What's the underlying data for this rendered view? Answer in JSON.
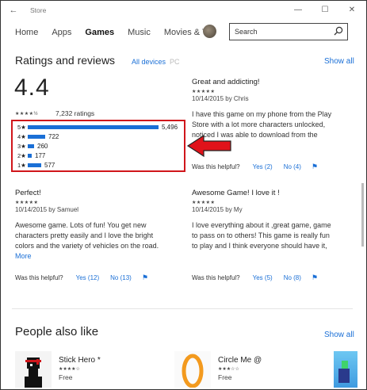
{
  "window": {
    "title": "Store",
    "back_glyph": "←",
    "min_glyph": "—",
    "max_glyph": "☐",
    "close_glyph": "✕"
  },
  "nav": {
    "tabs": [
      "Home",
      "Apps",
      "Games",
      "Music",
      "Movies & TV"
    ],
    "active": "Games",
    "search_placeholder": "Search"
  },
  "ratings": {
    "title": "Ratings and reviews",
    "filter_all": "All devices",
    "filter_pc": "PC",
    "show_all": "Show all",
    "average": "4.4",
    "average_stars": "★★★★½",
    "total": "7,232 ratings",
    "histogram": [
      {
        "label": "5★",
        "count": "5,496",
        "value": 5496
      },
      {
        "label": "4★",
        "count": "722",
        "value": 722
      },
      {
        "label": "3★",
        "count": "260",
        "value": 260
      },
      {
        "label": "2★",
        "count": "177",
        "value": 177
      },
      {
        "label": "1★",
        "count": "577",
        "value": 577
      }
    ]
  },
  "reviews": [
    {
      "title": "Great and addicting!",
      "stars": "★★★★★",
      "meta": "10/14/2015 by Chris",
      "body_lines": [
        "I have this game on my phone from the Play",
        "Store with a lot more characters unlocked,",
        "noticed I was able to download from the"
      ],
      "helpful": "Was this helpful?",
      "yes": "Yes (2)",
      "no": "No (4)"
    },
    {
      "title": "Perfect!",
      "stars": "★★★★★",
      "meta": "10/14/2015 by Samuel",
      "body_lines": [
        "Awesome game. Lots of fun! You get new",
        "characters pretty easily and I love the bright",
        "colors and the variety of vehicles on the road."
      ],
      "more": "More",
      "helpful": "Was this helpful?",
      "yes": "Yes (12)",
      "no": "No (13)"
    },
    {
      "title": "Awesome Game! I love it !",
      "stars": "★★★★★",
      "meta": "10/14/2015 by My",
      "body_lines": [
        "I love everything about it ,great game, game",
        "to pass on to others! This game is really fun",
        "to play and I think everyone should have it,"
      ],
      "helpful": "Was this helpful?",
      "yes": "Yes (5)",
      "no": "No (8)"
    }
  ],
  "people": {
    "title": "People also like",
    "show_all": "Show all",
    "apps": [
      {
        "name": "Stick Hero *",
        "stars": "★★★★☆",
        "price": "Free"
      },
      {
        "name": "Circle Me @",
        "stars": "★★★☆☆",
        "price": "Free"
      }
    ]
  }
}
